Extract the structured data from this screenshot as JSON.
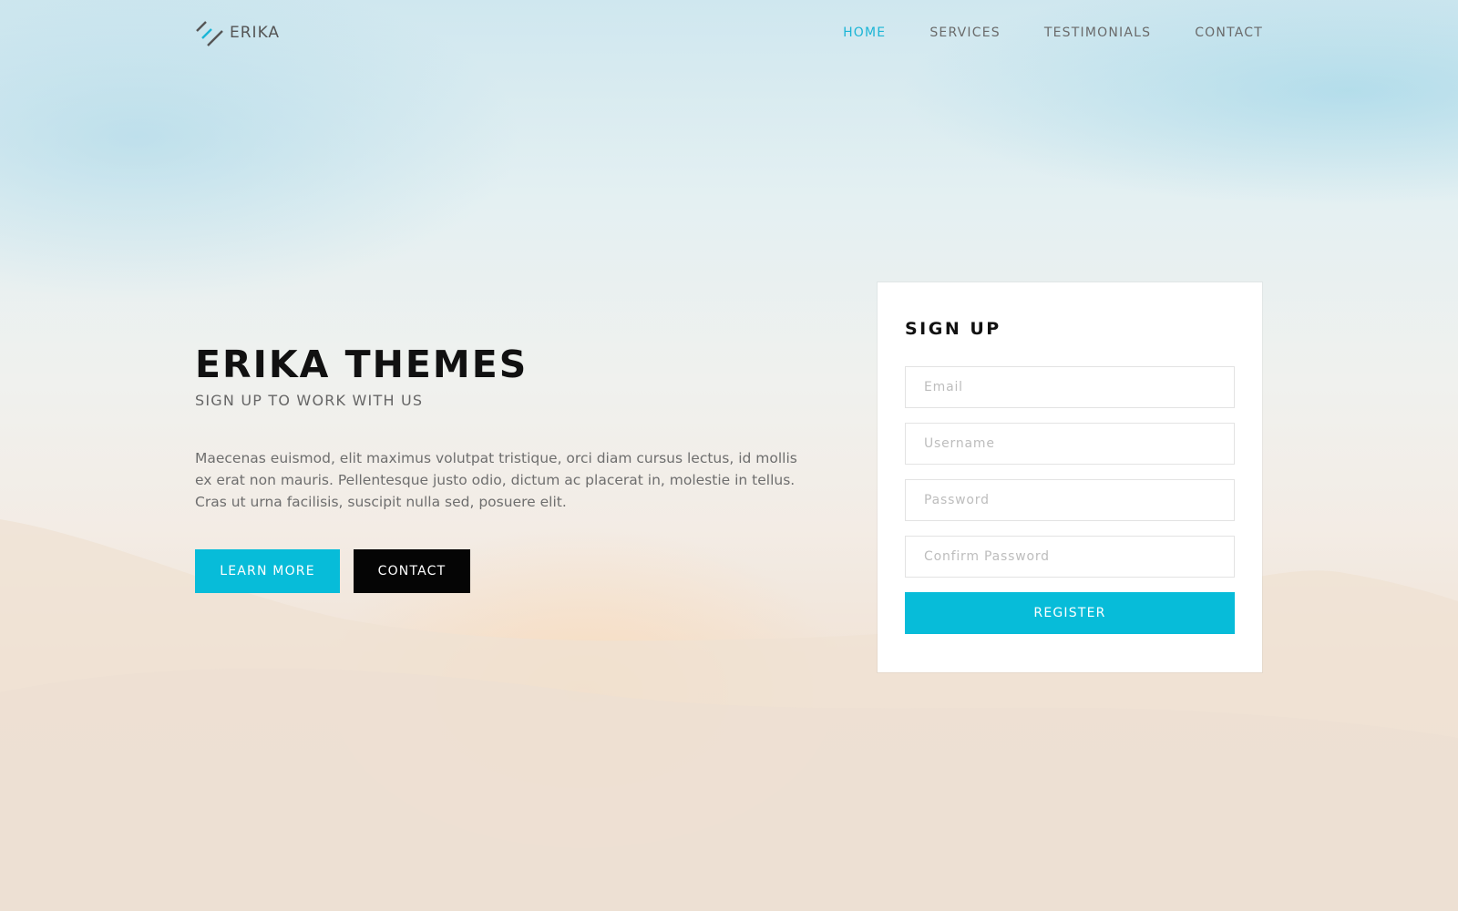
{
  "brand": {
    "name": "ERIKA",
    "logo_icon": "double-slash-logo-icon"
  },
  "nav": {
    "items": [
      {
        "label": "HOME",
        "active": true
      },
      {
        "label": "SERVICES",
        "active": false
      },
      {
        "label": "TESTIMONIALS",
        "active": false
      },
      {
        "label": "CONTACT",
        "active": false
      }
    ]
  },
  "hero": {
    "title": "ERIKA THEMES",
    "subtitle": "SIGN UP TO WORK WITH US",
    "body": "Maecenas euismod, elit maximus volutpat tristique, orci diam cursus lectus, id mollis ex erat non mauris. Pellentesque justo odio, dictum ac placerat in, molestie in tellus. Cras ut urna facilisis, suscipit nulla sed, posuere elit.",
    "primary_button": "LEARN MORE",
    "secondary_button": "CONTACT"
  },
  "signup": {
    "title": "SIGN UP",
    "email_placeholder": "Email",
    "username_placeholder": "Username",
    "password_placeholder": "Password",
    "confirm_placeholder": "Confirm Password",
    "register_label": "REGISTER"
  },
  "colors": {
    "accent": "#07bcd9",
    "dark": "#050505"
  }
}
